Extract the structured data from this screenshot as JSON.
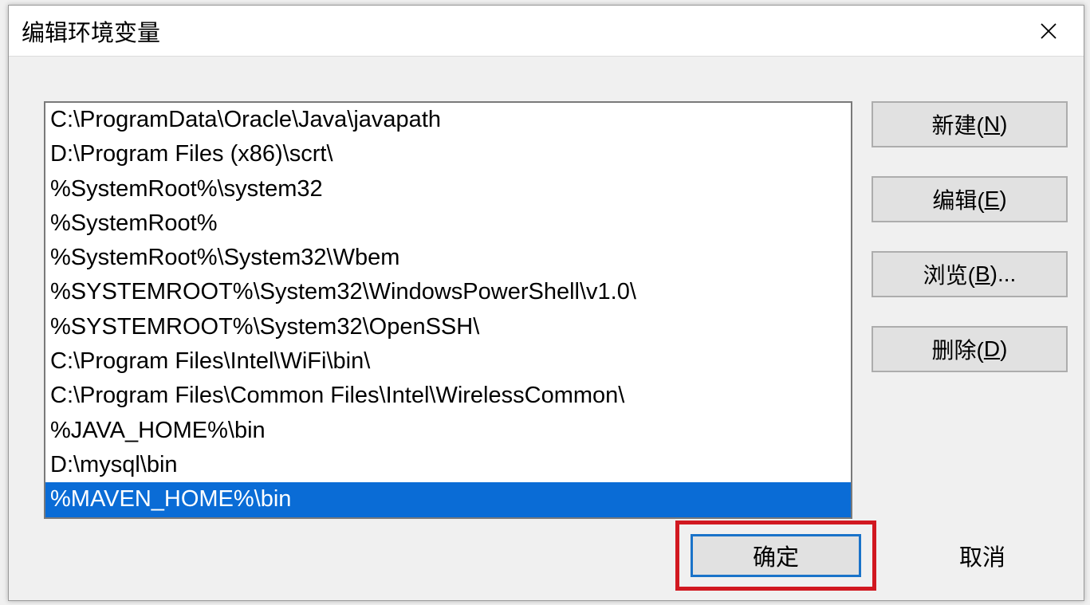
{
  "window": {
    "title": "编辑环境变量"
  },
  "list": {
    "items": [
      {
        "value": "C:\\ProgramData\\Oracle\\Java\\javapath",
        "selected": false
      },
      {
        "value": "D:\\Program Files (x86)\\scrt\\",
        "selected": false
      },
      {
        "value": "%SystemRoot%\\system32",
        "selected": false
      },
      {
        "value": "%SystemRoot%",
        "selected": false
      },
      {
        "value": "%SystemRoot%\\System32\\Wbem",
        "selected": false
      },
      {
        "value": "%SYSTEMROOT%\\System32\\WindowsPowerShell\\v1.0\\",
        "selected": false
      },
      {
        "value": "%SYSTEMROOT%\\System32\\OpenSSH\\",
        "selected": false
      },
      {
        "value": "C:\\Program Files\\Intel\\WiFi\\bin\\",
        "selected": false
      },
      {
        "value": "C:\\Program Files\\Common Files\\Intel\\WirelessCommon\\",
        "selected": false
      },
      {
        "value": "%JAVA_HOME%\\bin",
        "selected": false
      },
      {
        "value": "D:\\mysql\\bin",
        "selected": false
      },
      {
        "value": "%MAVEN_HOME%\\bin",
        "selected": true
      }
    ]
  },
  "buttons": {
    "new": {
      "prefix": "新建(",
      "mnemonic": "N",
      "suffix": ")"
    },
    "edit": {
      "prefix": "编辑(",
      "mnemonic": "E",
      "suffix": ")"
    },
    "browse": {
      "prefix": "浏览(",
      "mnemonic": "B",
      "suffix": ")..."
    },
    "delete": {
      "prefix": "删除(",
      "mnemonic": "D",
      "suffix": ")"
    },
    "ok": "确定",
    "cancel": "取消"
  },
  "colors": {
    "selection_bg": "#0a6cd6",
    "highlight_border": "#d11820",
    "focus_border": "#1a73c9"
  }
}
